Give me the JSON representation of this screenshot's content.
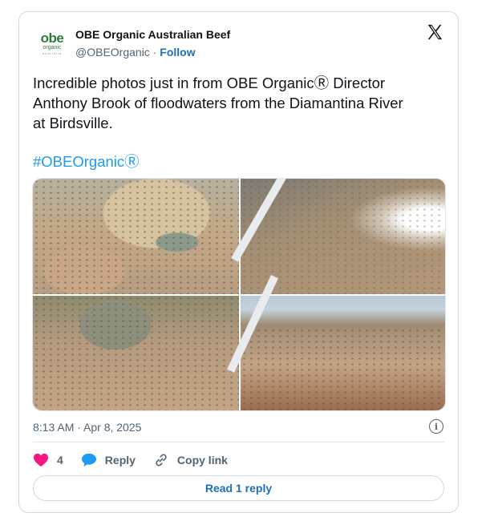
{
  "author": {
    "name": "OBE Organic Australian Beef",
    "handle": "@OBEOrganic",
    "separator": "·",
    "follow_label": "Follow",
    "avatar_text": "obe",
    "avatar_subtext": "organic",
    "avatar_subtext2": "australia"
  },
  "tweet": {
    "text_line1": "Incredible photos just in from OBE OrganicⓇ Director",
    "text_line2": "Anthony Brook of floodwaters from the Diamantina River",
    "text_line3": "at Birdsville.",
    "hashtag": "#OBEOrganicⓇ",
    "timestamp": "8:13 AM · Apr 8, 2025"
  },
  "media": {
    "photos": [
      {
        "icon": "flooded-town-aerial-photo"
      },
      {
        "icon": "floodwater-plane-wing-photo"
      },
      {
        "icon": "flooded-streets-aerial-photo"
      },
      {
        "icon": "flood-plain-horizon-photo"
      }
    ]
  },
  "actions": {
    "like_count": "4",
    "reply_label": "Reply",
    "copy_link_label": "Copy link",
    "read_replies_label": "Read 1 reply"
  },
  "colors": {
    "like": "#f91880",
    "link": "#1d9bf0",
    "reply_bubble": "#1d9bf0",
    "muted": "#536471"
  }
}
